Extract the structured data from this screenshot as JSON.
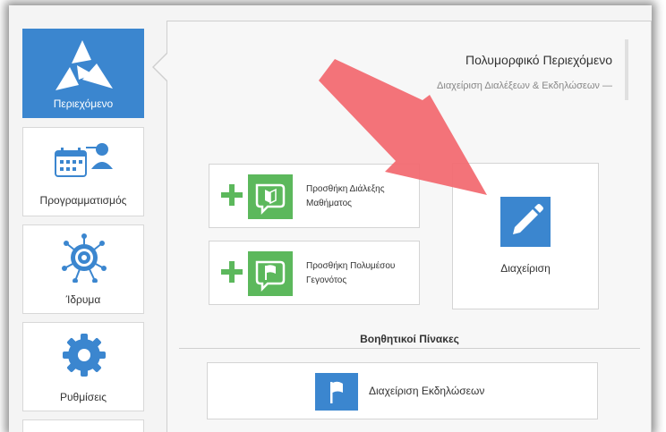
{
  "sidebar": {
    "items": [
      {
        "label": "Περιεχόμενο",
        "icon": "content-logo-icon",
        "active": true
      },
      {
        "label": "Προγραμματισμός",
        "icon": "calendar-user-icon",
        "active": false
      },
      {
        "label": "Ίδρυμα",
        "icon": "institution-network-icon",
        "active": false
      },
      {
        "label": "Ρυθμίσεις",
        "icon": "gear-icon",
        "active": false
      }
    ]
  },
  "panel": {
    "title": "Πολυμορφικό Περιεχόμενο",
    "subtitle": "Διαχείριση Διαλέξεων & Εκδηλώσεων —"
  },
  "actions": [
    {
      "label_line1": "Προσθήκη Διάλεξης",
      "label_line2": "Μαθήματος",
      "icon": "book-icon"
    },
    {
      "label_line1": "Προσθήκη Πολυμέσου",
      "label_line2": "Γεγονότος",
      "icon": "flag-chat-icon"
    }
  ],
  "manage": {
    "label": "Διαχείριση",
    "icon": "pencil-icon"
  },
  "helpers": {
    "section_title": "Βοηθητικοί Πίνακες",
    "items": [
      {
        "label": "Διαχείριση Εκδηλώσεων",
        "icon": "flag-icon"
      }
    ]
  },
  "colors": {
    "accent_blue": "#3b86cf",
    "green": "#5cb85c",
    "highlight_arrow": "#f26b72"
  }
}
